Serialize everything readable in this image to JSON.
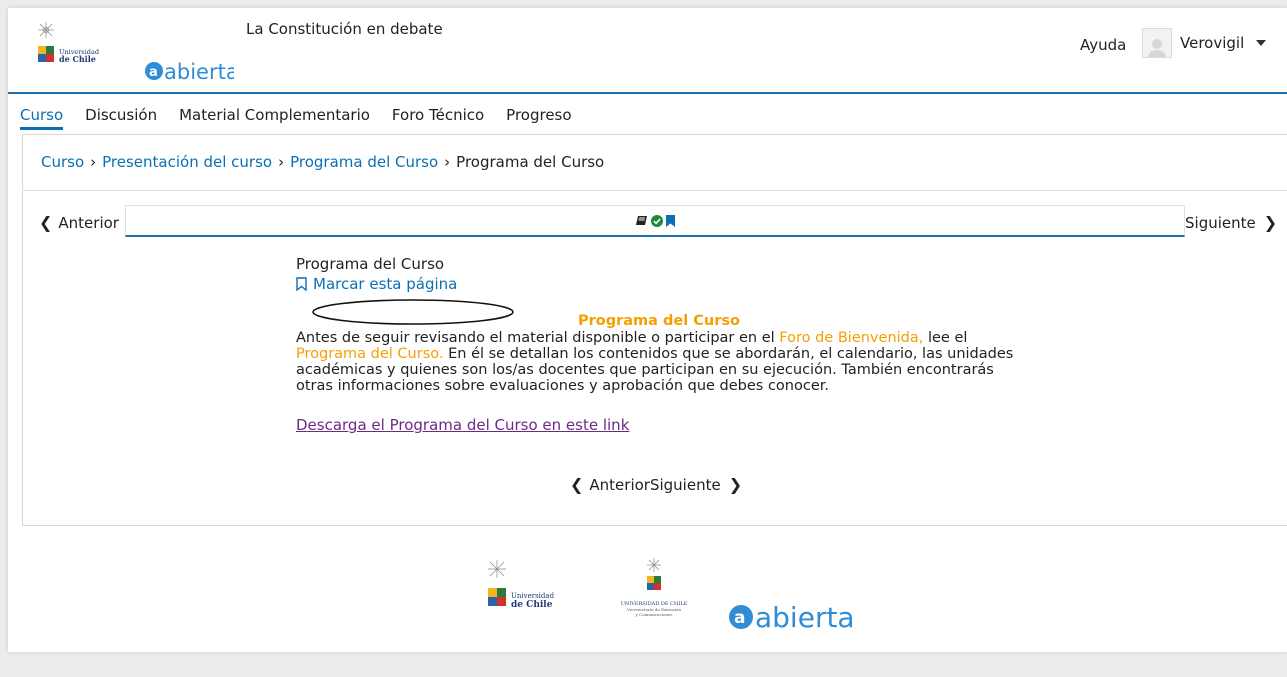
{
  "header": {
    "course_title": "La Constitución en debate",
    "help": "Ayuda",
    "username": "Verovigil",
    "logo_university_line1": "Universidad",
    "logo_university_line2": "de Chile",
    "logo_abierta": "abierta"
  },
  "tabs": [
    {
      "label": "Curso",
      "active": true
    },
    {
      "label": "Discusión",
      "active": false
    },
    {
      "label": "Material Complementario",
      "active": false
    },
    {
      "label": "Foro Técnico",
      "active": false
    },
    {
      "label": "Progreso",
      "active": false
    }
  ],
  "breadcrumb": {
    "items": [
      "Curso",
      "Presentación del curso",
      "Programa del Curso"
    ],
    "current": "Programa del Curso",
    "separator": "›"
  },
  "sequence": {
    "prev_label": "Anterior",
    "next_label": "Siguiente"
  },
  "content": {
    "unit_title": "Programa del Curso",
    "bookmark_label": "Marcar esta página",
    "heading": "Programa del Curso",
    "para_1": "Antes de seguir revisando el material disponible o participar en el ",
    "para_link_1": "Foro de Bienvenida,",
    "para_2": "  lee el ",
    "para_link_2": "Programa del Curso.",
    "para_3": " En él se detallan los contenidos que se abordarán, el calendario, las unidades académicas y quienes son los/as docentes que participan en su ejecución. También encontrarás otras informaciones sobre evaluaciones y aprobación que debes conocer.",
    "download_link": "Descarga el Programa del Curso en este link"
  },
  "bottom_nav": {
    "prev_label": "Anterior",
    "next_label": "Siguiente"
  },
  "footer": {
    "uchile_line1": "Universidad",
    "uchile_line2": "de Chile",
    "vice_line1": "UNIVERSIDAD DE CHILE",
    "vice_line2": "Vicerrectoría de Extensión",
    "vice_line3": "y Comunicaciones",
    "abierta": "abierta"
  },
  "colors": {
    "accent": "#0a6fb5",
    "highlight": "#f5a000",
    "visited_link": "#6c2a84"
  }
}
